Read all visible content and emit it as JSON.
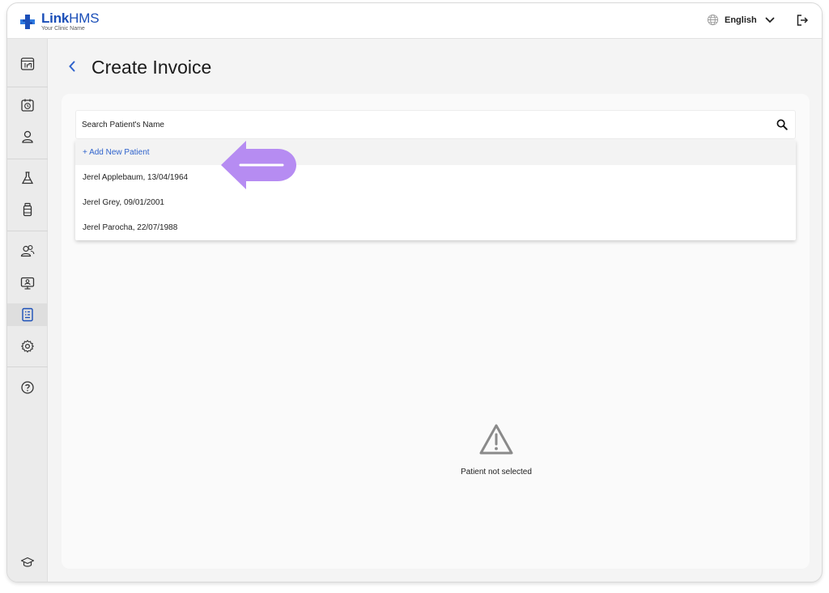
{
  "brand": {
    "name_bold": "Link",
    "name_light": "HMS",
    "subtitle": "Your Clinic Name",
    "color": "#1b4fb8"
  },
  "header": {
    "language": "English",
    "icons": [
      "globe-icon",
      "chevron-down-icon",
      "logout-icon"
    ]
  },
  "sidebar": {
    "items": [
      {
        "icon": "dashboard-icon"
      },
      {
        "icon": "appointments-icon"
      },
      {
        "icon": "patient-icon"
      },
      {
        "icon": "lab-icon"
      },
      {
        "icon": "pharmacy-icon"
      },
      {
        "icon": "staff-icon"
      },
      {
        "icon": "telemedicine-icon"
      },
      {
        "icon": "invoice-icon",
        "active": true
      },
      {
        "icon": "settings-icon"
      },
      {
        "icon": "help-icon"
      },
      {
        "icon": "academy-icon"
      }
    ]
  },
  "page": {
    "title": "Create Invoice"
  },
  "search": {
    "placeholder": "Search Patient's Name",
    "value": ""
  },
  "dropdown": {
    "add_label": "+ Add New Patient",
    "patients": [
      "Jerel Applebaum, 13/04/1964",
      "Jerel Grey, 09/01/2001",
      "Jerel Parocha, 22/07/1988"
    ]
  },
  "empty_state": {
    "message": "Patient not selected"
  },
  "colors": {
    "accent": "#2f63cc",
    "annotation_arrow": "#b68cf2"
  }
}
